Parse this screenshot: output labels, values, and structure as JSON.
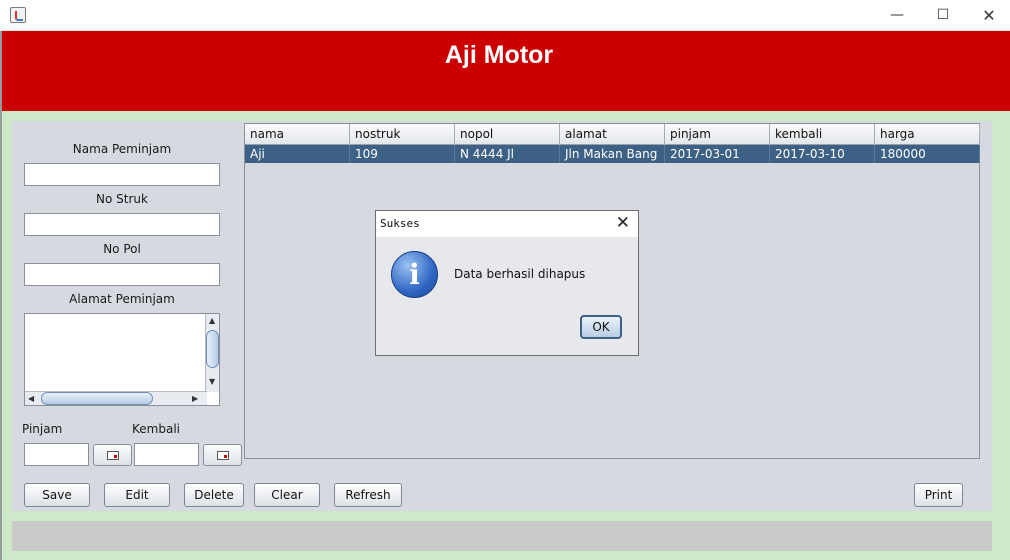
{
  "window": {
    "minimize_glyph": "—",
    "maximize_glyph": "☐",
    "close_glyph": "✕"
  },
  "header": {
    "title": "Aji Motor"
  },
  "form": {
    "nama_label": "Nama Peminjam",
    "nostruk_label": "No Struk",
    "nopol_label": "No Pol",
    "alamat_label": "Alamat Peminjam",
    "pinjam_label": "Pinjam",
    "kembali_label": "Kembali"
  },
  "table": {
    "columns": [
      "nama",
      "nostruk",
      "nopol",
      "alamat",
      "pinjam",
      "kembali",
      "harga"
    ],
    "rows": [
      [
        "Aji",
        "109",
        "N 4444 Jl",
        "Jln Makan Bang",
        "2017-03-01",
        "2017-03-10",
        "180000"
      ]
    ]
  },
  "buttons": {
    "save": "Save",
    "edit": "Edit",
    "delete": "Delete",
    "clear": "Clear",
    "refresh": "Refresh",
    "print": "Print"
  },
  "dialog": {
    "title": "Sukses",
    "close_glyph": "✕",
    "icon_glyph": "i",
    "message": "Data berhasil dihapus",
    "ok": "OK"
  },
  "colors": {
    "header_bg": "#cc0000",
    "frame_bg": "#cde9c7",
    "selected_row": "#3d6185"
  }
}
